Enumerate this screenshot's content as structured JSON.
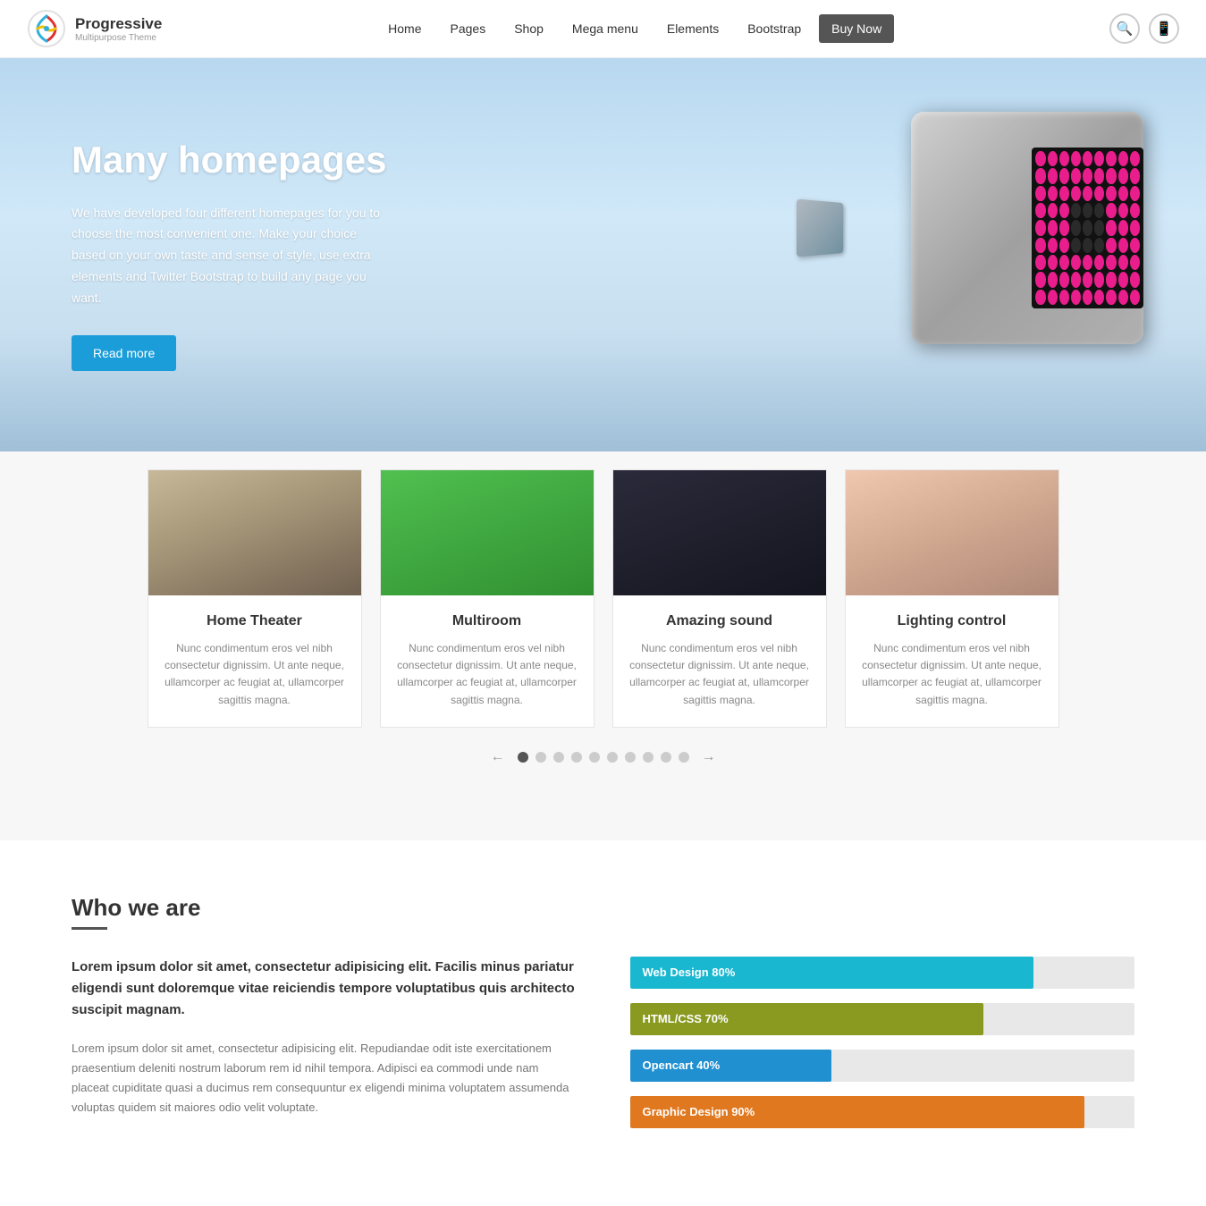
{
  "header": {
    "logo_title": "Progressive",
    "logo_subtitle": "Multipurpose Theme",
    "nav_items": [
      {
        "label": "Home",
        "href": "#"
      },
      {
        "label": "Pages",
        "href": "#"
      },
      {
        "label": "Shop",
        "href": "#"
      },
      {
        "label": "Mega menu",
        "href": "#"
      },
      {
        "label": "Elements",
        "href": "#"
      },
      {
        "label": "Bootstrap",
        "href": "#"
      },
      {
        "label": "Buy Now",
        "href": "#",
        "special": true
      }
    ]
  },
  "hero": {
    "title": "Many homepages",
    "text": "We have developed four different homepages for you to choose the most convenient one. Make your choice based on your own taste and sense of style, use extra elements and Twitter Bootstrap to build any page you want.",
    "cta_label": "Read more"
  },
  "cards": {
    "items": [
      {
        "title": "Home Theater",
        "text": "Nunc condimentum eros vel nibh consectetur dignissim. Ut ante neque, ullamcorper ac feugiat at, ullamcorper sagittis magna.",
        "img_type": "office"
      },
      {
        "title": "Multiroom",
        "text": "Nunc condimentum eros vel nibh consectetur dignissim. Ut ante neque, ullamcorper ac feugiat at, ullamcorper sagittis magna.",
        "img_type": "phone-screen"
      },
      {
        "title": "Amazing sound",
        "text": "Nunc condimentum eros vel nibh consectetur dignissim. Ut ante neque, ullamcorper ac feugiat at, ullamcorper sagittis magna.",
        "img_type": "dark-tablet"
      },
      {
        "title": "Lighting control",
        "text": "Nunc condimentum eros vel nibh consectetur dignissim. Ut ante neque, ullamcorper ac feugiat at, ullamcorper sagittis magna.",
        "img_type": "magazine-page"
      }
    ],
    "pagination_dots": 10,
    "active_dot": 1
  },
  "who_section": {
    "title": "Who we are",
    "intro": "Lorem ipsum dolor sit amet, consectetur adipisicing elit. Facilis minus pariatur eligendi sunt doloremque vitae reiciendis tempore voluptatibus quis architecto suscipit magnam.",
    "body": "Lorem ipsum dolor sit amet, consectetur adipisicing elit. Repudiandae odit iste exercitationem praesentium deleniti nostrum laborum rem id nihil tempora. Adipisci ea commodi unde nam placeat cupiditate quasi a ducimus rem consequuntur ex eligendi minima voluptatem assumenda voluptas quidem sit maiores odio velit voluptate.",
    "skills": [
      {
        "label": "Web Design 80%",
        "pct": 80,
        "color": "bar-teal"
      },
      {
        "label": "HTML/CSS 70%",
        "pct": 70,
        "color": "bar-olive"
      },
      {
        "label": "Opencart 40%",
        "pct": 40,
        "color": "bar-blue"
      },
      {
        "label": "Graphic Design 90%",
        "pct": 90,
        "color": "bar-orange"
      }
    ]
  }
}
